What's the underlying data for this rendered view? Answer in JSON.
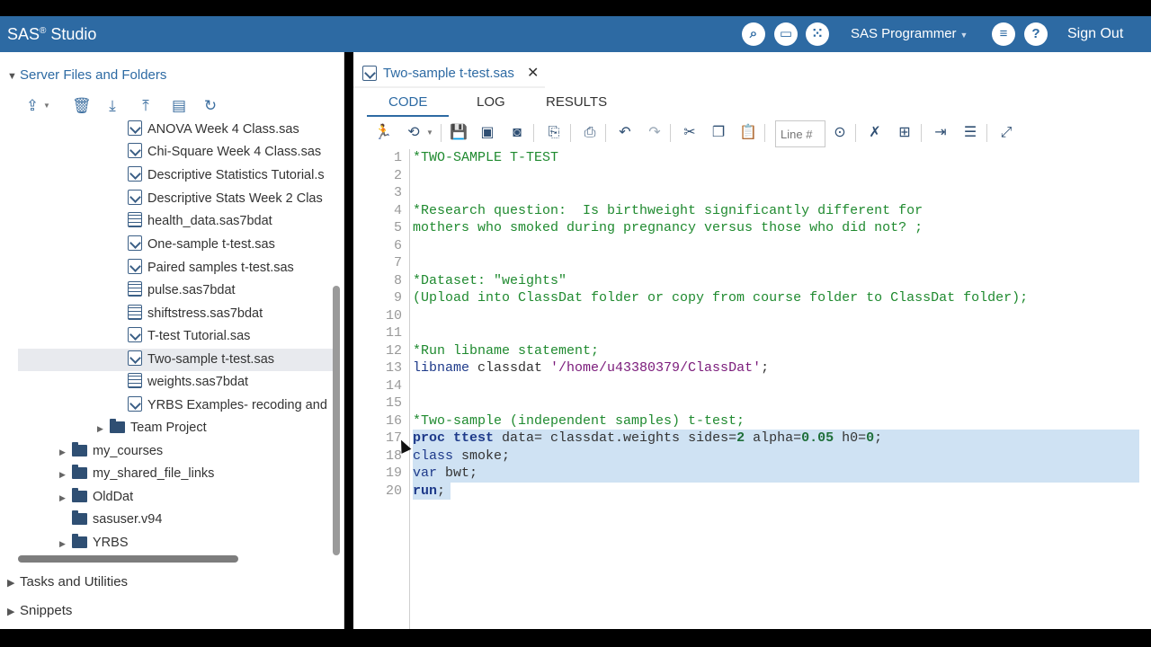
{
  "app": {
    "brand": "SAS",
    "brand_sup": "®",
    "brand_rest": " Studio",
    "perspective": "SAS Programmer",
    "sign_out": "Sign Out"
  },
  "topbar_icons": [
    "search-icon",
    "open-folder-icon",
    "apps-grid-icon",
    "menu-list-icon",
    "help-icon"
  ],
  "left": {
    "section_server": "Server Files and Folders",
    "section_tasks": "Tasks and Utilities",
    "section_snippets": "Snippets",
    "tree": [
      {
        "label": "ANOVA Week 4 Class.sas",
        "kind": "sas"
      },
      {
        "label": "Chi-Square Week 4 Class.sas",
        "kind": "sas"
      },
      {
        "label": "Descriptive Statistics Tutorial.s",
        "kind": "sas"
      },
      {
        "label": "Descriptive Stats Week 2 Clas",
        "kind": "sas"
      },
      {
        "label": "health_data.sas7bdat",
        "kind": "data"
      },
      {
        "label": "One-sample t-test.sas",
        "kind": "sas"
      },
      {
        "label": "Paired samples t-test.sas",
        "kind": "sas"
      },
      {
        "label": "pulse.sas7bdat",
        "kind": "data"
      },
      {
        "label": "shiftstress.sas7bdat",
        "kind": "data"
      },
      {
        "label": "T-test Tutorial.sas",
        "kind": "sas"
      },
      {
        "label": "Two-sample t-test.sas",
        "kind": "sas"
      },
      {
        "label": "weights.sas7bdat",
        "kind": "data"
      },
      {
        "label": "YRBS Examples- recoding and",
        "kind": "sas"
      },
      {
        "label": "Team Project",
        "kind": "folder"
      },
      {
        "label": "my_courses",
        "kind": "folder"
      },
      {
        "label": "my_shared_file_links",
        "kind": "folder"
      },
      {
        "label": "OldDat",
        "kind": "folder"
      },
      {
        "label": "sasuser.v94",
        "kind": "folder"
      },
      {
        "label": "YRBS",
        "kind": "folder"
      }
    ]
  },
  "editor": {
    "file_tab": "Two-sample t-test.sas",
    "close_glyph": "✕",
    "tabs": {
      "code": "CODE",
      "log": "LOG",
      "results": "RESULTS"
    },
    "line_placeholder": "Line #",
    "line_numbers": [
      "1",
      "2",
      "3",
      "4",
      "5",
      "6",
      "7",
      "8",
      "9",
      "10",
      "11",
      "12",
      "13",
      "14",
      "15",
      "16",
      "17",
      "18",
      "19",
      "20"
    ],
    "lines": {
      "l1": "*TWO-SAMPLE T-TEST",
      "l4": "*Research question:  Is birthweight significantly different for",
      "l5": "mothers who smoked during pregnancy versus those who did not? ;",
      "l8": "*Dataset: \"weights\"",
      "l9": "(Upload into ClassDat folder or copy from course folder to ClassDat folder);",
      "l12": "*Run libname statement;",
      "l13_kw": "libname",
      "l13_a": " classdat ",
      "l13_str": "'/home/u43380379/ClassDat'",
      "l13_b": ";",
      "l16": "*Two-sample (independent samples) t-test;",
      "l17_kw": "proc ttest",
      "l17_a": " data= classdat.weights ",
      "l17_b": "sides=",
      "l17_n1": "2",
      "l17_c": " alpha=",
      "l17_n2": "0.05",
      "l17_d": " h0=",
      "l17_n3": "0",
      "l17_e": ";",
      "l18_kw": "class",
      "l18_a": " smoke;",
      "l19_kw": "var",
      "l19_a": " bwt;",
      "l20_kw": "run",
      "l20_a": ";"
    }
  }
}
